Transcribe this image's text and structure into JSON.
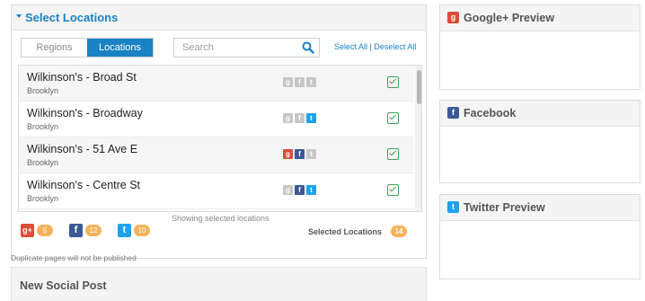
{
  "select_panel": {
    "title": "Select Locations",
    "tabs": [
      {
        "label": "Regions",
        "active": false
      },
      {
        "label": "Locations",
        "active": true
      }
    ],
    "search": {
      "placeholder": "Search",
      "value": ""
    },
    "select_all": "Select All",
    "separator": " | ",
    "deselect_all": "Deselect All"
  },
  "locations": [
    {
      "name": "Wilkinson's - Broad St",
      "city": "Brooklyn",
      "google": false,
      "facebook": false,
      "twitter": false,
      "checked": true
    },
    {
      "name": "Wilkinson's - Broadway",
      "city": "Brooklyn",
      "google": false,
      "facebook": false,
      "twitter": true,
      "checked": true
    },
    {
      "name": "Wilkinson's - 51 Ave E",
      "city": "Brooklyn",
      "google": true,
      "facebook": true,
      "twitter": false,
      "checked": true
    },
    {
      "name": "Wilkinson's - Centre St",
      "city": "Brooklyn",
      "google": false,
      "facebook": true,
      "twitter": true,
      "checked": true
    }
  ],
  "showing_text": "Showing selected locations",
  "counts": {
    "google": "5",
    "facebook": "12",
    "twitter": "10"
  },
  "selected_label": "Selected Locations",
  "selected_count": "14",
  "duplicate_note": "Duplicate pages will not be published",
  "new_post_title": "New Social Post",
  "previews": {
    "google": "Google+ Preview",
    "facebook": "Facebook",
    "twitter": "Twitter Preview"
  },
  "colors": {
    "accent": "#1a82c4",
    "google": "#dd4b39",
    "facebook": "#3b5998",
    "twitter": "#1da1f2",
    "check": "#3aa65b",
    "badge": "#f5b25b"
  },
  "icons": {
    "google": "google-plus-icon",
    "facebook": "facebook-icon",
    "twitter": "twitter-icon",
    "search": "search-icon",
    "caret": "caret-down-icon",
    "check": "checkbox-checked-icon"
  }
}
